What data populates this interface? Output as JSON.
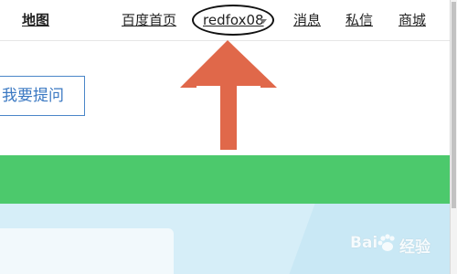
{
  "topnav": {
    "items": [
      {
        "label": "地图"
      },
      {
        "label": "百度首页"
      },
      {
        "label": "消息"
      },
      {
        "label": "私信"
      },
      {
        "label": "商城"
      }
    ],
    "user": {
      "name": "redfox08"
    }
  },
  "main": {
    "ask_button_label": "我要提问"
  },
  "watermark": {
    "left": "Bai",
    "right": "经验"
  },
  "colors": {
    "banner": "#4cc96c",
    "arrow": "#e0684a",
    "ask_button_border": "#4a86c8",
    "blue_area": "#d6eef8"
  }
}
